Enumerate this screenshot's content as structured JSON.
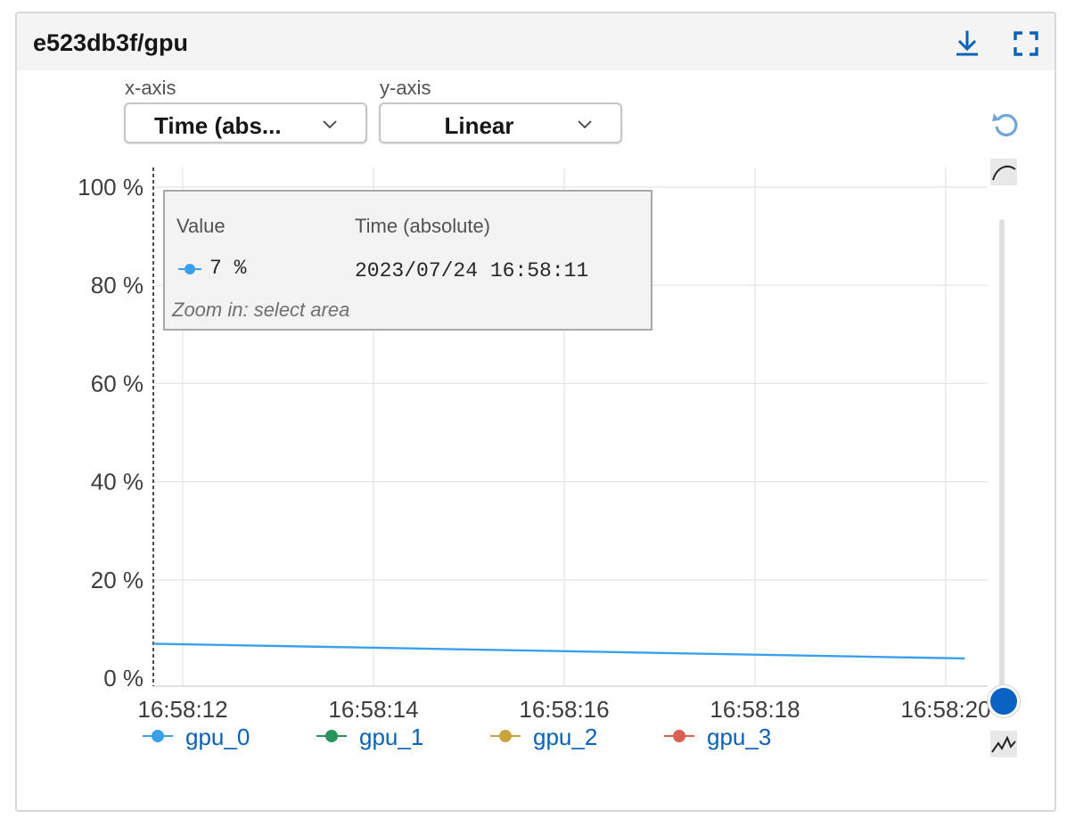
{
  "card": {
    "title": "e523db3f/gpu",
    "download_icon": "download-icon",
    "fullscreen_icon": "fullscreen-icon"
  },
  "controls": {
    "xaxis_label": "x-axis",
    "xaxis_value": "Time (abs...",
    "yaxis_label": "y-axis",
    "yaxis_value": "Linear"
  },
  "tooltip": {
    "value_header": "Value",
    "time_header": "Time (absolute)",
    "value": "7 %",
    "time": "2023/07/24 16:58:11",
    "hint": "Zoom in: select area",
    "swatch_color": "#3aa0ee"
  },
  "side_controls": {
    "reset_icon": "reset-icon",
    "smooth_icon": "smoothed-curve-icon",
    "raw_icon": "raw-line-icon",
    "smoothing_level": 0
  },
  "chart_data": {
    "type": "line",
    "x": [
      "16:58:11",
      "16:58:20.2"
    ],
    "xticks": [
      "16:58:12",
      "16:58:14",
      "16:58:16",
      "16:58:18",
      "16:58:20"
    ],
    "yticks": [
      "0 %",
      "20 %",
      "40 %",
      "60 %",
      "80 %",
      "100 %"
    ],
    "ylim": [
      0,
      100
    ],
    "grid": true,
    "hover_x": "16:58:11",
    "series": [
      {
        "name": "gpu_0",
        "color": "#3aa0ee",
        "values": [
          7,
          4
        ]
      },
      {
        "name": "gpu_1",
        "color": "#27945c",
        "values": []
      },
      {
        "name": "gpu_2",
        "color": "#c9a43d",
        "values": []
      },
      {
        "name": "gpu_3",
        "color": "#d9604e",
        "values": []
      }
    ],
    "legend_position": "bottom"
  }
}
